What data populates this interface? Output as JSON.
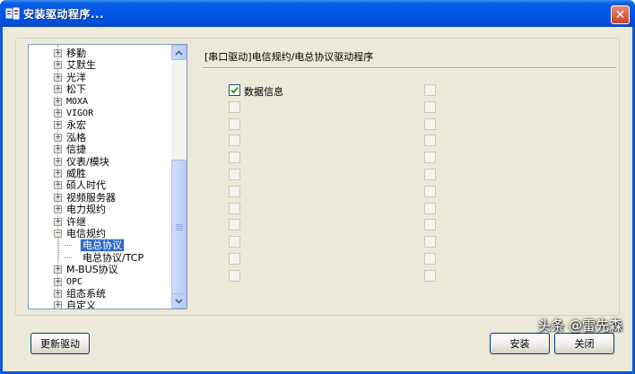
{
  "window": {
    "title": "安装驱动程序..."
  },
  "tree": {
    "items": [
      {
        "label": "移勤",
        "mono": false
      },
      {
        "label": "艾默生",
        "mono": false
      },
      {
        "label": "光洋",
        "mono": false
      },
      {
        "label": "松下",
        "mono": false
      },
      {
        "label": "MOXA",
        "mono": true
      },
      {
        "label": "VIGOR",
        "mono": true
      },
      {
        "label": "永宏",
        "mono": false
      },
      {
        "label": "泓格",
        "mono": false
      },
      {
        "label": "信捷",
        "mono": false
      },
      {
        "label": "仪表/模块",
        "mono": false
      },
      {
        "label": "威胜",
        "mono": false
      },
      {
        "label": "硕人时代",
        "mono": false
      },
      {
        "label": "视频服务器",
        "mono": false
      },
      {
        "label": "电力规约",
        "mono": false
      },
      {
        "label": "许继",
        "mono": false
      },
      {
        "label": "电信规约",
        "mono": false,
        "expanded": true
      },
      {
        "label": "电总协议",
        "child": true,
        "selected": true
      },
      {
        "label": "电总协议/TCP",
        "child": true
      },
      {
        "label": "M-BUS协议",
        "mono": false
      },
      {
        "label": "OPC",
        "mono": true
      },
      {
        "label": "组态系统",
        "mono": false
      },
      {
        "label": "自定义",
        "mono": false
      }
    ]
  },
  "panel": {
    "title": "[串口驱动]电信规约/电总协议驱动程序",
    "left_checkboxes": [
      {
        "label": "数据信息",
        "checked": true
      },
      {
        "label": "",
        "checked": false
      },
      {
        "label": "",
        "checked": false
      },
      {
        "label": "",
        "checked": false
      },
      {
        "label": "",
        "checked": false
      },
      {
        "label": "",
        "checked": false
      },
      {
        "label": "",
        "checked": false
      },
      {
        "label": "",
        "checked": false
      },
      {
        "label": "",
        "checked": false
      },
      {
        "label": "",
        "checked": false
      },
      {
        "label": "",
        "checked": false
      },
      {
        "label": "",
        "checked": false
      }
    ],
    "right_checkboxes_count": 12
  },
  "buttons": {
    "update": "更新驱动",
    "install": "安装",
    "close": "关闭"
  },
  "watermark": "头条 @雷先森",
  "colors": {
    "titlebar": "#0054e3",
    "selection": "#316ac5",
    "dialog_bg": "#ece9d8"
  }
}
